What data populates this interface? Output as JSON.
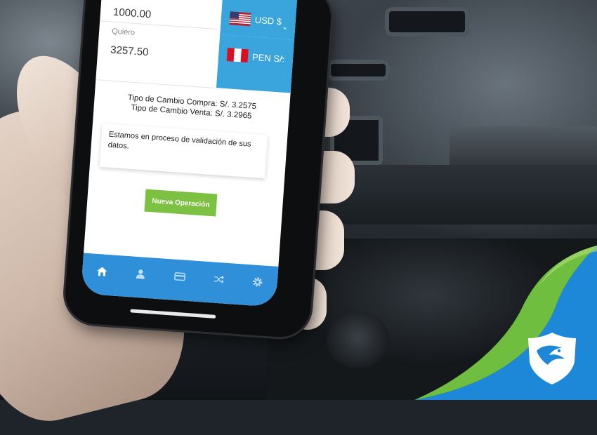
{
  "converter": {
    "have_value": "1000.00",
    "want_label": "Quiero",
    "want_value": "3257.50",
    "from_currency": {
      "code": "USD $",
      "flag": "us-flag-icon"
    },
    "to_currency": {
      "code": "PEN S/.",
      "flag": "peru-flag-icon"
    }
  },
  "rates": {
    "buy": "Tipo de Cambio Compra: S/. 3.2575",
    "sell": "Tipo de Cambio Venta: S/. 3.2965"
  },
  "notice": "Estamos en proceso de validación de sus datos.",
  "actions": {
    "new_operation": "Nueva Operación"
  },
  "tabbar": {
    "items": [
      {
        "icon": "home-icon",
        "active": true
      },
      {
        "icon": "user-icon",
        "active": false
      },
      {
        "icon": "card-icon",
        "active": false
      },
      {
        "icon": "shuffle-icon",
        "active": false
      },
      {
        "icon": "gear-icon",
        "active": false
      }
    ]
  },
  "colors": {
    "primary_blue": "#2f8fd8",
    "currency_blue": "#39a5dc",
    "accent_green": "#7dc142",
    "curl_blue": "#1e88d8"
  }
}
